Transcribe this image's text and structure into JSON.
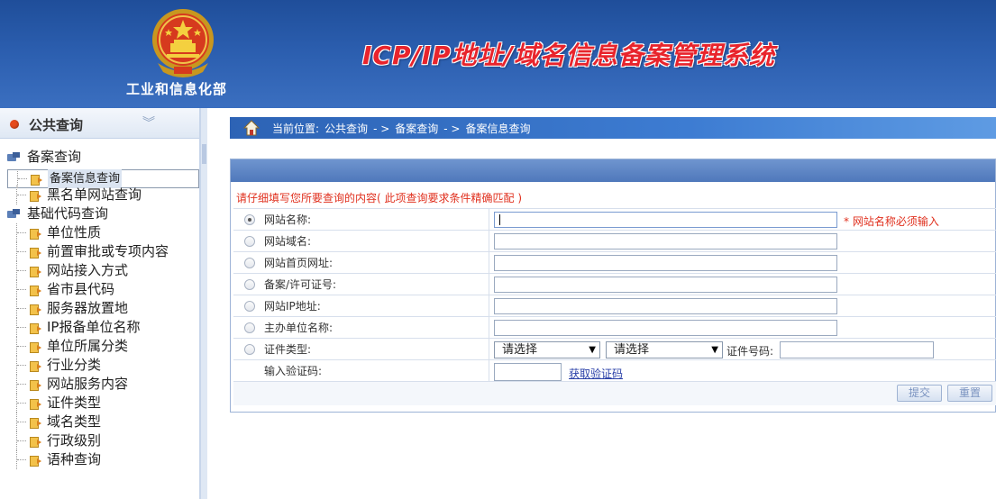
{
  "header": {
    "ministry": "工业和信息化部",
    "system_title": "ICP/IP地址/域名信息备案管理系统"
  },
  "sidebar": {
    "title": "公共查询",
    "groups": [
      {
        "label": "备案查询",
        "items": [
          {
            "label": "备案信息查询",
            "selected": true
          },
          {
            "label": "黑名单网站查询"
          }
        ]
      },
      {
        "label": "基础代码查询",
        "items": [
          {
            "label": "单位性质"
          },
          {
            "label": "前置审批或专项内容"
          },
          {
            "label": "网站接入方式"
          },
          {
            "label": "省市县代码"
          },
          {
            "label": "服务器放置地"
          },
          {
            "label": "IP报备单位名称"
          },
          {
            "label": "单位所属分类"
          },
          {
            "label": "行业分类"
          },
          {
            "label": "网站服务内容"
          },
          {
            "label": "证件类型"
          },
          {
            "label": "域名类型"
          },
          {
            "label": "行政级别"
          },
          {
            "label": "语种查询"
          }
        ]
      }
    ]
  },
  "breadcrumb": {
    "prefix": "当前位置:",
    "path1": "公共查询",
    "sep1": "- >",
    "path2": "备案查询",
    "sep2": "- >",
    "path3": "备案信息查询"
  },
  "form": {
    "hint": "请仔细填写您所要查询的内容( 此项查询要求条件精确匹配 )",
    "fields": [
      {
        "label": "网站名称:",
        "required_note": "* 网站名称必须输入"
      },
      {
        "label": "网站域名:"
      },
      {
        "label": "网站首页网址:"
      },
      {
        "label": "备案/许可证号:"
      },
      {
        "label": "网站IP地址:"
      },
      {
        "label": "主办单位名称:"
      }
    ],
    "cert": {
      "label": "证件类型:",
      "select1": "请选择",
      "select2": "请选择",
      "number_label": "证件号码:"
    },
    "captcha": {
      "label": "输入验证码:",
      "link": "获取验证码"
    },
    "submit": "提交",
    "reset": "重置"
  }
}
